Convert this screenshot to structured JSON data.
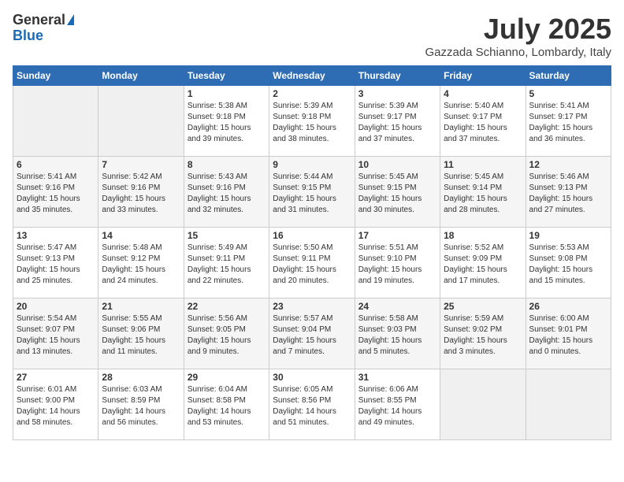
{
  "header": {
    "logo_line1": "General",
    "logo_line2": "Blue",
    "month": "July 2025",
    "location": "Gazzada Schianno, Lombardy, Italy"
  },
  "days_of_week": [
    "Sunday",
    "Monday",
    "Tuesday",
    "Wednesday",
    "Thursday",
    "Friday",
    "Saturday"
  ],
  "weeks": [
    [
      {
        "day": "",
        "info": ""
      },
      {
        "day": "",
        "info": ""
      },
      {
        "day": "1",
        "info": "Sunrise: 5:38 AM\nSunset: 9:18 PM\nDaylight: 15 hours and 39 minutes."
      },
      {
        "day": "2",
        "info": "Sunrise: 5:39 AM\nSunset: 9:18 PM\nDaylight: 15 hours and 38 minutes."
      },
      {
        "day": "3",
        "info": "Sunrise: 5:39 AM\nSunset: 9:17 PM\nDaylight: 15 hours and 37 minutes."
      },
      {
        "day": "4",
        "info": "Sunrise: 5:40 AM\nSunset: 9:17 PM\nDaylight: 15 hours and 37 minutes."
      },
      {
        "day": "5",
        "info": "Sunrise: 5:41 AM\nSunset: 9:17 PM\nDaylight: 15 hours and 36 minutes."
      }
    ],
    [
      {
        "day": "6",
        "info": "Sunrise: 5:41 AM\nSunset: 9:16 PM\nDaylight: 15 hours and 35 minutes."
      },
      {
        "day": "7",
        "info": "Sunrise: 5:42 AM\nSunset: 9:16 PM\nDaylight: 15 hours and 33 minutes."
      },
      {
        "day": "8",
        "info": "Sunrise: 5:43 AM\nSunset: 9:16 PM\nDaylight: 15 hours and 32 minutes."
      },
      {
        "day": "9",
        "info": "Sunrise: 5:44 AM\nSunset: 9:15 PM\nDaylight: 15 hours and 31 minutes."
      },
      {
        "day": "10",
        "info": "Sunrise: 5:45 AM\nSunset: 9:15 PM\nDaylight: 15 hours and 30 minutes."
      },
      {
        "day": "11",
        "info": "Sunrise: 5:45 AM\nSunset: 9:14 PM\nDaylight: 15 hours and 28 minutes."
      },
      {
        "day": "12",
        "info": "Sunrise: 5:46 AM\nSunset: 9:13 PM\nDaylight: 15 hours and 27 minutes."
      }
    ],
    [
      {
        "day": "13",
        "info": "Sunrise: 5:47 AM\nSunset: 9:13 PM\nDaylight: 15 hours and 25 minutes."
      },
      {
        "day": "14",
        "info": "Sunrise: 5:48 AM\nSunset: 9:12 PM\nDaylight: 15 hours and 24 minutes."
      },
      {
        "day": "15",
        "info": "Sunrise: 5:49 AM\nSunset: 9:11 PM\nDaylight: 15 hours and 22 minutes."
      },
      {
        "day": "16",
        "info": "Sunrise: 5:50 AM\nSunset: 9:11 PM\nDaylight: 15 hours and 20 minutes."
      },
      {
        "day": "17",
        "info": "Sunrise: 5:51 AM\nSunset: 9:10 PM\nDaylight: 15 hours and 19 minutes."
      },
      {
        "day": "18",
        "info": "Sunrise: 5:52 AM\nSunset: 9:09 PM\nDaylight: 15 hours and 17 minutes."
      },
      {
        "day": "19",
        "info": "Sunrise: 5:53 AM\nSunset: 9:08 PM\nDaylight: 15 hours and 15 minutes."
      }
    ],
    [
      {
        "day": "20",
        "info": "Sunrise: 5:54 AM\nSunset: 9:07 PM\nDaylight: 15 hours and 13 minutes."
      },
      {
        "day": "21",
        "info": "Sunrise: 5:55 AM\nSunset: 9:06 PM\nDaylight: 15 hours and 11 minutes."
      },
      {
        "day": "22",
        "info": "Sunrise: 5:56 AM\nSunset: 9:05 PM\nDaylight: 15 hours and 9 minutes."
      },
      {
        "day": "23",
        "info": "Sunrise: 5:57 AM\nSunset: 9:04 PM\nDaylight: 15 hours and 7 minutes."
      },
      {
        "day": "24",
        "info": "Sunrise: 5:58 AM\nSunset: 9:03 PM\nDaylight: 15 hours and 5 minutes."
      },
      {
        "day": "25",
        "info": "Sunrise: 5:59 AM\nSunset: 9:02 PM\nDaylight: 15 hours and 3 minutes."
      },
      {
        "day": "26",
        "info": "Sunrise: 6:00 AM\nSunset: 9:01 PM\nDaylight: 15 hours and 0 minutes."
      }
    ],
    [
      {
        "day": "27",
        "info": "Sunrise: 6:01 AM\nSunset: 9:00 PM\nDaylight: 14 hours and 58 minutes."
      },
      {
        "day": "28",
        "info": "Sunrise: 6:03 AM\nSunset: 8:59 PM\nDaylight: 14 hours and 56 minutes."
      },
      {
        "day": "29",
        "info": "Sunrise: 6:04 AM\nSunset: 8:58 PM\nDaylight: 14 hours and 53 minutes."
      },
      {
        "day": "30",
        "info": "Sunrise: 6:05 AM\nSunset: 8:56 PM\nDaylight: 14 hours and 51 minutes."
      },
      {
        "day": "31",
        "info": "Sunrise: 6:06 AM\nSunset: 8:55 PM\nDaylight: 14 hours and 49 minutes."
      },
      {
        "day": "",
        "info": ""
      },
      {
        "day": "",
        "info": ""
      }
    ]
  ]
}
